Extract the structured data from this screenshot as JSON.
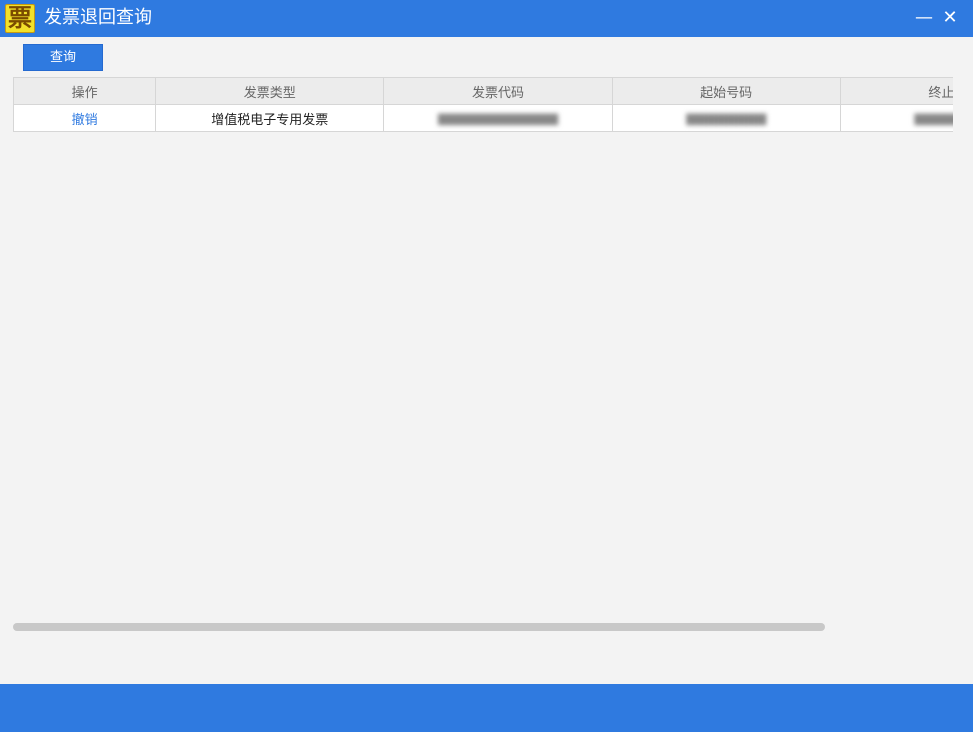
{
  "window": {
    "title": "发票退回查询",
    "app_icon_glyph": "票",
    "minimize_glyph": "—",
    "close_glyph": "✕"
  },
  "toolbar": {
    "query_label": "查询"
  },
  "table": {
    "columns": [
      "操作",
      "发票类型",
      "发票代码",
      "起始号码",
      "终止号码"
    ],
    "rows": [
      {
        "action": "撤销",
        "invoice_type": "增值税电子专用发票",
        "invoice_code": "",
        "start_number": "",
        "end_number": ""
      }
    ]
  },
  "colors": {
    "accent": "#2f7ae0",
    "background": "#f3f3f3",
    "header_bg": "#ececec",
    "link": "#2f7ae0"
  }
}
